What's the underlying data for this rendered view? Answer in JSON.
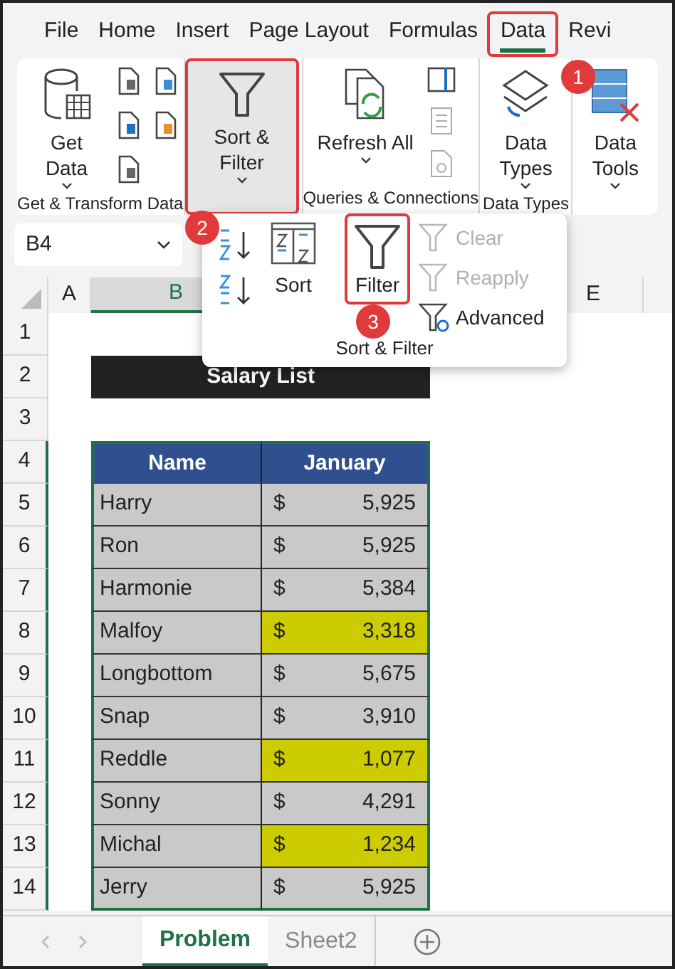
{
  "menu_tabs": [
    {
      "label": "File",
      "selected": false
    },
    {
      "label": "Home",
      "selected": false
    },
    {
      "label": "Insert",
      "selected": false
    },
    {
      "label": "Page Layout",
      "selected": false
    },
    {
      "label": "Formulas",
      "selected": false
    },
    {
      "label": "Data",
      "selected": true
    },
    {
      "label": "Revi",
      "selected": false
    }
  ],
  "ribbon": {
    "get_data": "Get Data",
    "sort_filter": "Sort & Filter",
    "refresh_all": "Refresh All",
    "data_types": "Data Types",
    "data_tools": "Data Tools",
    "groups": [
      "Get & Transform Data",
      "Queries & Connections",
      "Data Types"
    ]
  },
  "dropdown": {
    "sort": "Sort",
    "filter": "Filter",
    "clear": {
      "label": "Clear",
      "disabled": true
    },
    "reapply": {
      "label": "Reapply",
      "disabled": true
    },
    "advanced": {
      "label": "Advanced",
      "disabled": false
    },
    "group_label": "Sort & Filter"
  },
  "name_box": "B4",
  "columns": [
    {
      "label": "A",
      "selected": false
    },
    {
      "label": "B",
      "selected": true
    },
    {
      "label": "E",
      "selected": false
    }
  ],
  "row_numbers": [
    {
      "label": "1",
      "selected": false
    },
    {
      "label": "2",
      "selected": false
    },
    {
      "label": "3",
      "selected": false
    },
    {
      "label": "4",
      "selected": true
    },
    {
      "label": "5",
      "selected": true
    },
    {
      "label": "6",
      "selected": true
    },
    {
      "label": "7",
      "selected": true
    },
    {
      "label": "8",
      "selected": true
    },
    {
      "label": "9",
      "selected": true
    },
    {
      "label": "10",
      "selected": true
    },
    {
      "label": "11",
      "selected": true
    },
    {
      "label": "12",
      "selected": true
    },
    {
      "label": "13",
      "selected": true
    },
    {
      "label": "14",
      "selected": true
    }
  ],
  "title": "Salary List",
  "table": {
    "columns": [
      "Name",
      "January"
    ],
    "rows": [
      {
        "name": "Harry",
        "currency": "$",
        "value": "5,925",
        "highlighted": false
      },
      {
        "name": "Ron",
        "currency": "$",
        "value": "5,925",
        "highlighted": false
      },
      {
        "name": "Harmonie",
        "currency": "$",
        "value": "5,384",
        "highlighted": false
      },
      {
        "name": "Malfoy",
        "currency": "$",
        "value": "3,318",
        "highlighted": true
      },
      {
        "name": "Longbottom",
        "currency": "$",
        "value": "5,675",
        "highlighted": false
      },
      {
        "name": "Snap",
        "currency": "$",
        "value": "3,910",
        "highlighted": false
      },
      {
        "name": "Reddle",
        "currency": "$",
        "value": "1,077",
        "highlighted": true
      },
      {
        "name": "Sonny",
        "currency": "$",
        "value": "4,291",
        "highlighted": false
      },
      {
        "name": "Michal",
        "currency": "$",
        "value": "1,234",
        "highlighted": true
      },
      {
        "name": "Jerry",
        "currency": "$",
        "value": "5,925",
        "highlighted": false
      }
    ]
  },
  "step_markers": [
    "1",
    "2",
    "3"
  ],
  "sheet_tabs": [
    {
      "label": "Problem",
      "selected": true
    },
    {
      "label": "Sheet2",
      "selected": false
    }
  ]
}
